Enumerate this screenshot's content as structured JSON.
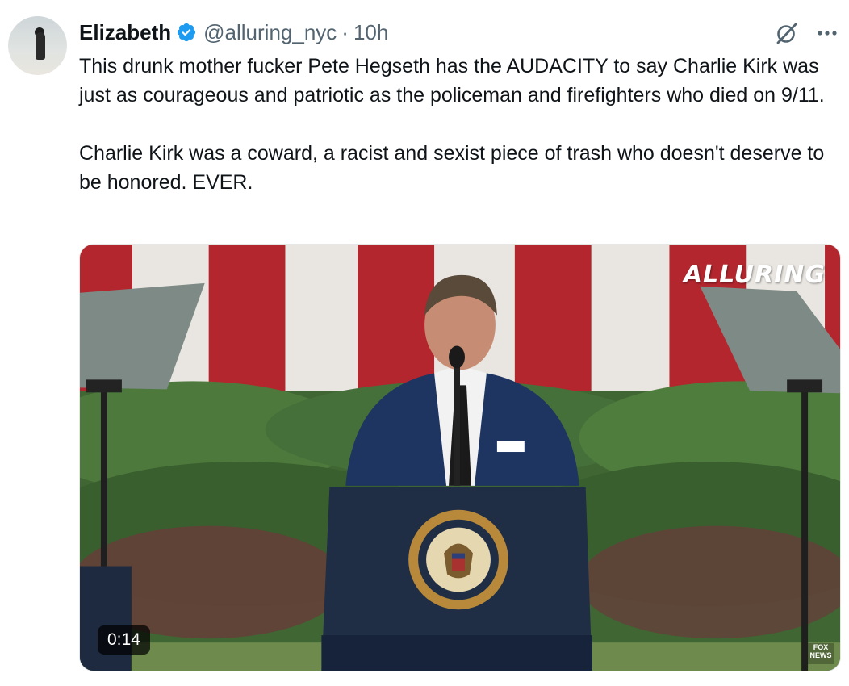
{
  "author": {
    "display_name": "Elizabeth",
    "handle": "@alluring_nyc",
    "separator": "·",
    "timestamp": "10h",
    "verified": true,
    "verified_color": "#1d9bf0"
  },
  "actions": {
    "grok_icon": "grok-icon",
    "more_icon": "more-icon"
  },
  "tweet": {
    "paragraphs": [
      "This drunk mother fucker Pete Hegseth has the AUDACITY to say Charlie Kirk was just as courageous and patriotic as the policeman and firefighters who died on 9/11.",
      "Charlie Kirk was a coward, a racist and sexist piece of trash who doesn't deserve to be honored. EVER."
    ]
  },
  "video": {
    "watermark": "ALLURING",
    "duration": "0:14",
    "seal_text_top": "PRESIDENT OF THE UNITED",
    "seal_text_bottom": "SEAL OF THE · STATES",
    "network_logo_line1": "FOX",
    "network_logo_line2": "NEWS"
  },
  "colors": {
    "text_primary": "#0f1419",
    "text_secondary": "#536471",
    "flag_red": "#b3262e",
    "flag_white": "#e9e6e1"
  }
}
